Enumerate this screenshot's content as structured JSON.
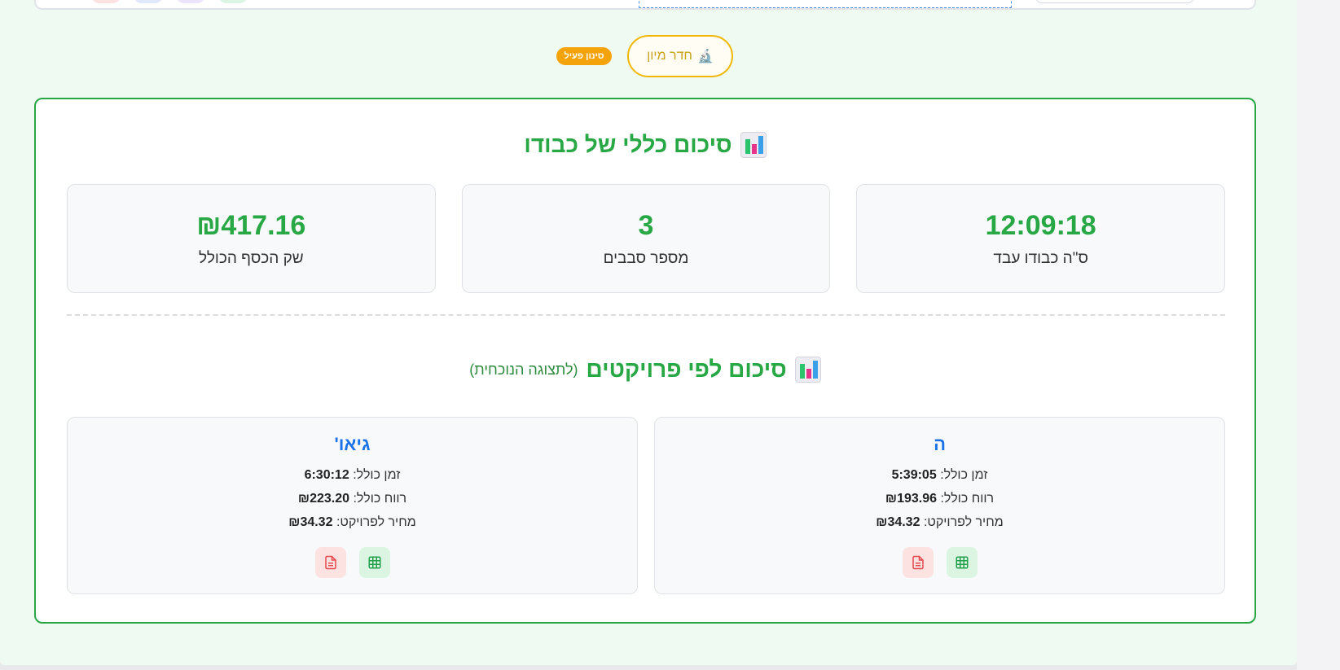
{
  "filter_bar": {
    "sort_room_label": "חדר מיון",
    "sort_room_icon": "microscope-icon",
    "filter_active_badge": "סינון פעיל"
  },
  "overall_summary": {
    "title": "סיכום כללי של כבודו",
    "title_icon": "bar-chart-icon",
    "stats": [
      {
        "value": "12:09:18",
        "label": "ס\"ה כבודו עבד"
      },
      {
        "value": "3",
        "label": "מספר סבבים"
      },
      {
        "value": "₪417.16",
        "label": "שק הכסף הכולל"
      }
    ]
  },
  "projects_summary": {
    "title": "סיכום לפי פרויקטים",
    "subtitle": "(לתצוגה הנוכחית)",
    "title_icon": "bar-chart-icon",
    "projects": [
      {
        "name": "ה",
        "total_time_label": "זמן כולל:",
        "total_time": "5:39:05",
        "total_profit_label": "רווח כולל:",
        "total_profit": "₪193.96",
        "price_label": "מחיר לפרויקט:",
        "price": "₪34.32"
      },
      {
        "name": "גיאו'",
        "total_time_label": "זמן כולל:",
        "total_time": "6:30:12",
        "total_profit_label": "רווח כולל:",
        "total_profit": "₪223.20",
        "price_label": "מחיר לפרויקט:",
        "price": "₪34.32"
      }
    ]
  },
  "colors": {
    "accent_green": "#28a745",
    "project_blue": "#1a73e8",
    "badge_orange": "#f5a30a",
    "sort_button_border": "#f2b705"
  }
}
